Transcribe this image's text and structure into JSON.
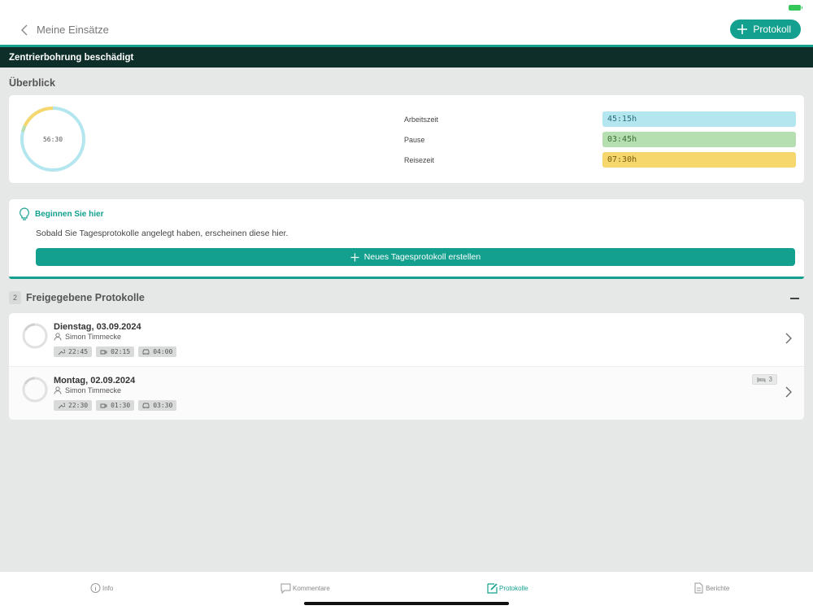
{
  "header": {
    "back_label": "Meine Einsätze",
    "protocol_button": "Protokoll",
    "title": "Zentrierbohrung beschädigt"
  },
  "overview": {
    "heading": "Überblick",
    "donut_total": "56:30",
    "stats": [
      {
        "label": "Arbeitszeit",
        "value": "45:15h",
        "color": "#b3e6ee"
      },
      {
        "label": "Pause",
        "value": "03:45h",
        "color": "#b5dfb0"
      },
      {
        "label": "Reisezeit",
        "value": "07:30h",
        "color": "#f5d76e"
      }
    ]
  },
  "start": {
    "heading": "Beginnen Sie hier",
    "text": "Sobald Sie Tagesprotokolle angelegt haben, erscheinen diese hier.",
    "button": "Neues Tagesprotokoll erstellen"
  },
  "released": {
    "count": "2",
    "heading": "Freigegebene Protokolle",
    "items": [
      {
        "date": "Dienstag, 03.09.2024",
        "user": "Simon Timmecke",
        "work": "22:45",
        "pause": "02:15",
        "travel": "04:00"
      },
      {
        "date": "Montag, 02.09.2024",
        "user": "Simon Timmecke",
        "work": "22:30",
        "pause": "01:30",
        "travel": "03:30",
        "overnight": "3"
      }
    ]
  },
  "tabs": {
    "info": "Info",
    "comments": "Kommentare",
    "protocols": "Protokolle",
    "reports": "Berichte"
  },
  "colors": {
    "accent": "#13a08e",
    "title_bar": "#0e2f29"
  }
}
